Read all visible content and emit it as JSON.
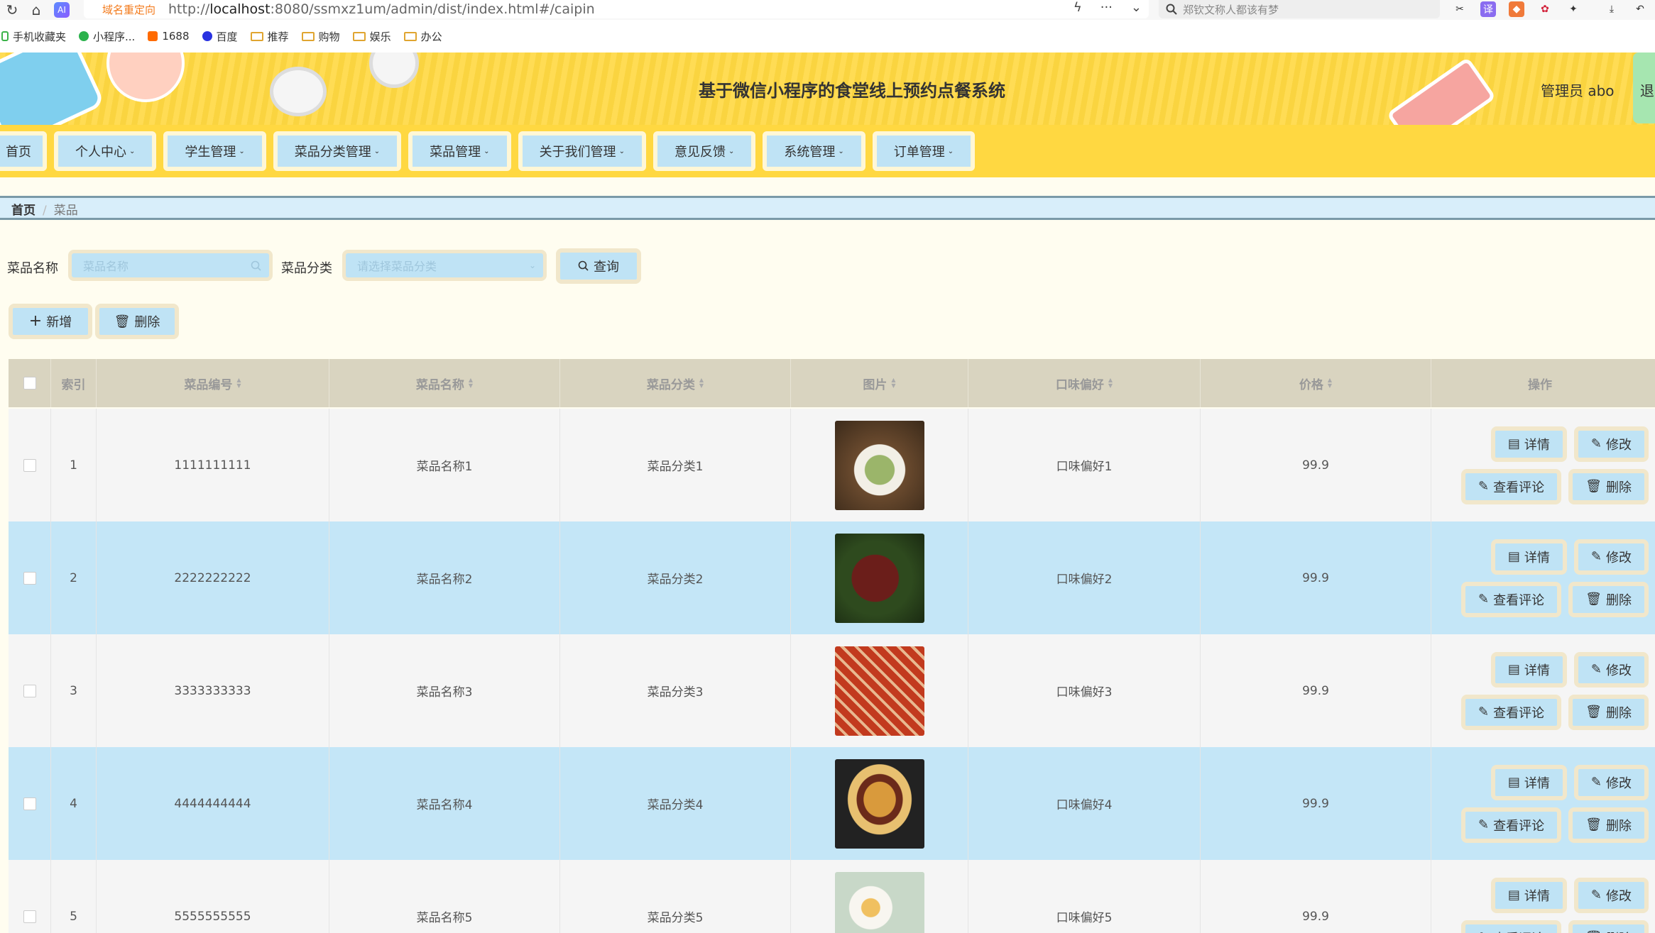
{
  "browser": {
    "redirect_tag": "域名重定向",
    "url_prefix": "http://",
    "url_host": "localhost",
    "url_rest": ":8080/ssmxz1um/admin/dist/index.html#/caipin",
    "search_text": "郑钦文称人都该有梦"
  },
  "bookmarks": [
    {
      "label": "手机收藏夹"
    },
    {
      "label": "小程序..."
    },
    {
      "label": "1688"
    },
    {
      "label": "百度"
    },
    {
      "label": "推荐"
    },
    {
      "label": "购物"
    },
    {
      "label": "娱乐"
    },
    {
      "label": "办公"
    }
  ],
  "header": {
    "title": "基于微信小程序的食堂线上预约点餐系统",
    "user": "管理员 abo",
    "logout": "退出"
  },
  "menu": [
    {
      "label": "首页"
    },
    {
      "label": "个人中心"
    },
    {
      "label": "学生管理"
    },
    {
      "label": "菜品分类管理"
    },
    {
      "label": "菜品管理"
    },
    {
      "label": "关于我们管理"
    },
    {
      "label": "意见反馈"
    },
    {
      "label": "系统管理"
    },
    {
      "label": "订单管理"
    }
  ],
  "breadcrumb": {
    "home": "首页",
    "current": "菜品"
  },
  "search": {
    "name_label": "菜品名称",
    "name_placeholder": "菜品名称",
    "cat_label": "菜品分类",
    "cat_placeholder": "请选择菜品分类",
    "query_button": "查询"
  },
  "actions": {
    "add": "新增",
    "delete": "删除"
  },
  "table": {
    "columns": [
      "索引",
      "菜品编号",
      "菜品名称",
      "菜品分类",
      "图片",
      "口味偏好",
      "价格",
      "操作"
    ],
    "row_actions": {
      "detail": "详情",
      "edit": "修改",
      "comments": "查看评论",
      "delete": "删除"
    },
    "rows": [
      {
        "index": "1",
        "code": "1111111111",
        "name": "菜品名称1",
        "category": "菜品分类1",
        "taste": "口味偏好1",
        "price": "99.9"
      },
      {
        "index": "2",
        "code": "2222222222",
        "name": "菜品名称2",
        "category": "菜品分类2",
        "taste": "口味偏好2",
        "price": "99.9"
      },
      {
        "index": "3",
        "code": "3333333333",
        "name": "菜品名称3",
        "category": "菜品分类3",
        "taste": "口味偏好3",
        "price": "99.9"
      },
      {
        "index": "4",
        "code": "4444444444",
        "name": "菜品名称4",
        "category": "菜品分类4",
        "taste": "口味偏好4",
        "price": "99.9"
      },
      {
        "index": "5",
        "code": "5555555555",
        "name": "菜品名称5",
        "category": "菜品分类5",
        "taste": "口味偏好5",
        "price": "99.9"
      }
    ]
  }
}
